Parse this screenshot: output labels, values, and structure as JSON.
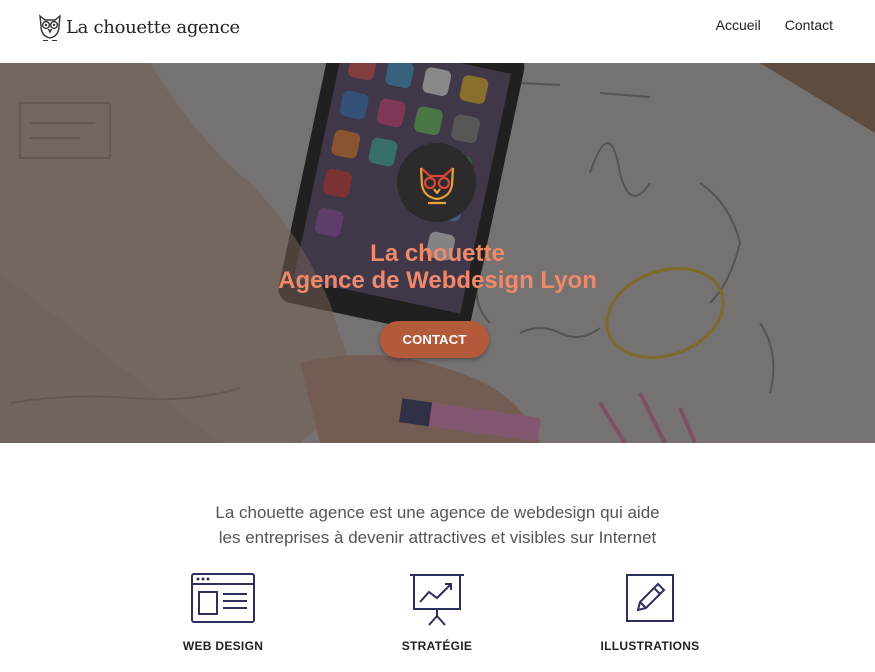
{
  "header": {
    "brand_name": "La chouette agence",
    "logo_icon": "owl-icon",
    "nav": [
      {
        "label": "Accueil"
      },
      {
        "label": "Contact"
      }
    ]
  },
  "hero": {
    "background": "desk-with-smartphone-and-sketches-photo",
    "badge_icon": "owl-logo-icon",
    "title_line1": "La chouette",
    "title_line2": "Agence de Webdesign Lyon",
    "cta_label": "CONTACT"
  },
  "intro": {
    "line1": "La chouette agence est une agence de webdesign qui aide",
    "line2": "les entreprises à devenir attractives et visibles sur Internet"
  },
  "services": [
    {
      "label": "WEB DESIGN",
      "icon": "browser-window-icon"
    },
    {
      "label": "STRATÉGIE",
      "icon": "presentation-chart-icon"
    },
    {
      "label": "ILLUSTRATIONS",
      "icon": "pencil-in-frame-icon"
    }
  ],
  "colors": {
    "accent": "#f0896a",
    "button": "#b35a3a",
    "icon_stroke": "#2d2f5e",
    "overlay": "#282424"
  }
}
